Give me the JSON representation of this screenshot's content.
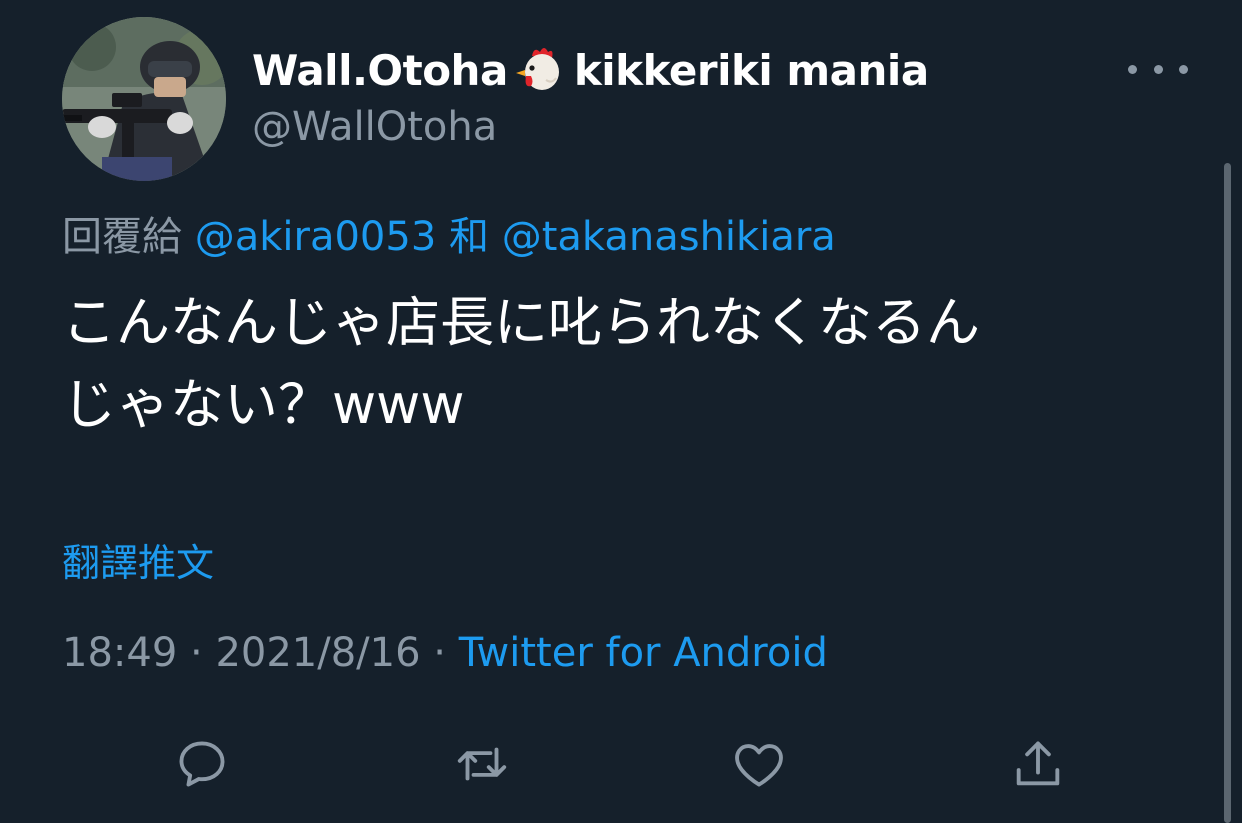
{
  "tweet": {
    "display_name": "Wall.Otoha",
    "display_name_suffix": "kikkeriki mania",
    "name_emoji": "rooster-emoji",
    "handle": "@WallOtoha",
    "reply_prefix": "回覆給",
    "reply_to_1": "@akira0053",
    "reply_joiner": "和",
    "reply_to_2": "@takanashikiara",
    "text_line1": "こんなんじゃ店長に叱られなくなるん",
    "text_line2": "じゃない？www",
    "translate_label": "翻譯推文",
    "time": "18:49",
    "separator": "·",
    "date": "2021/8/16",
    "source": "Twitter for Android"
  },
  "actions": [
    {
      "name": "reply",
      "icon": "comment-icon"
    },
    {
      "name": "retweet",
      "icon": "retweet-icon"
    },
    {
      "name": "like",
      "icon": "heart-icon"
    },
    {
      "name": "share",
      "icon": "share-icon"
    }
  ],
  "colors": {
    "background": "#15202b",
    "text": "#ffffff",
    "secondary_text": "#8b98a5",
    "accent": "#1d9bf0"
  }
}
